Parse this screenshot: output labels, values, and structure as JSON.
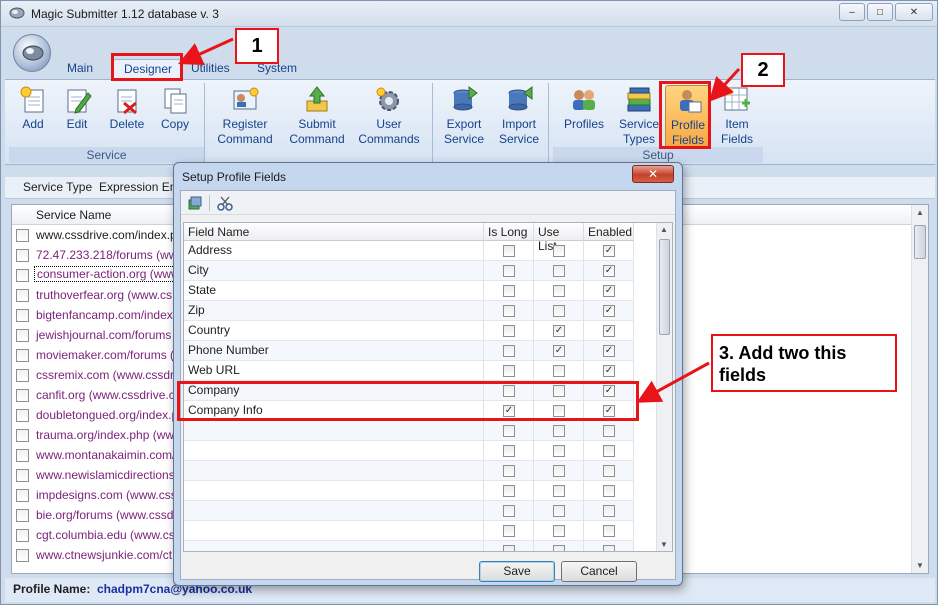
{
  "window": {
    "title": "Magic Submitter 1.12 database v. 3",
    "minimize": "–",
    "maximize": "□",
    "close": "✕"
  },
  "ribbon_tabs": [
    {
      "label": "Main"
    },
    {
      "label": "Designer"
    },
    {
      "label": "Utilities"
    },
    {
      "label": "System"
    }
  ],
  "ribbon": {
    "service_group": {
      "label": "Service",
      "buttons": [
        {
          "label": "Add"
        },
        {
          "label": "Edit"
        },
        {
          "label": "Delete"
        },
        {
          "label": "Copy"
        }
      ]
    },
    "command_group": {
      "buttons": [
        {
          "line1": "Register",
          "line2": "Command"
        },
        {
          "line1": "Submit",
          "line2": "Command"
        },
        {
          "line1": "User",
          "line2": "Commands"
        }
      ]
    },
    "export_group": {
      "buttons": [
        {
          "line1": "Export",
          "line2": "Service"
        },
        {
          "line1": "Import",
          "line2": "Service"
        }
      ]
    },
    "setup_group": {
      "label": "Setup",
      "buttons": [
        {
          "line1": "Profiles",
          "line2": ""
        },
        {
          "line1": "Service",
          "line2": "Types"
        },
        {
          "line1": "Profile",
          "line2": "Fields"
        },
        {
          "line1": "Item",
          "line2": "Fields"
        }
      ]
    }
  },
  "subbar": {
    "service_type": "Service Type",
    "expression": "Expression Eng"
  },
  "service_list": {
    "header": "Service Name",
    "rows": [
      "www.cssdrive.com/index.p",
      "72.47.233.218/forums  (ww",
      "consumer-action.org  (www",
      "truthoverfear.org  (www.cs",
      "bigtenfancamp.com/index.",
      "jewishjournal.com/forums  (",
      "moviemaker.com/forums  (",
      "cssremix.com (www.cssdri",
      "canfit.org (www.cssdrive.c",
      "doubletongued.org/index.p",
      "trauma.org/index.php  (ww",
      "www.montanakaimin.com/i",
      "www.newislamicdirections.",
      "impdesigns.com (www.css",
      "bie.org/forums  (www.cssdr",
      "cgt.columbia.edu  (www.cs",
      "www.ctnewsjunkie.com/ct"
    ]
  },
  "status": {
    "label": "Profile Name:",
    "value": "chadpm7cna@yahoo.co.uk"
  },
  "dialog": {
    "title": "Setup Profile Fields",
    "close": "✕",
    "columns": [
      "Field Name",
      "Is Long",
      "Use List",
      "Enabled"
    ],
    "rows": [
      {
        "name": "Address",
        "is_long": false,
        "use_list": false,
        "enabled": true
      },
      {
        "name": "City",
        "is_long": false,
        "use_list": false,
        "enabled": true
      },
      {
        "name": "State",
        "is_long": false,
        "use_list": false,
        "enabled": true
      },
      {
        "name": "Zip",
        "is_long": false,
        "use_list": false,
        "enabled": true
      },
      {
        "name": "Country",
        "is_long": false,
        "use_list": true,
        "enabled": true
      },
      {
        "name": "Phone Number",
        "is_long": false,
        "use_list": true,
        "enabled": true
      },
      {
        "name": "Web URL",
        "is_long": false,
        "use_list": false,
        "enabled": true
      },
      {
        "name": "Company",
        "is_long": false,
        "use_list": false,
        "enabled": true
      },
      {
        "name": "Company Info",
        "is_long": true,
        "use_list": false,
        "enabled": true
      },
      {
        "name": "",
        "is_long": false,
        "use_list": false,
        "enabled": false
      },
      {
        "name": "",
        "is_long": false,
        "use_list": false,
        "enabled": false
      },
      {
        "name": "",
        "is_long": false,
        "use_list": false,
        "enabled": false
      },
      {
        "name": "",
        "is_long": false,
        "use_list": false,
        "enabled": false
      },
      {
        "name": "",
        "is_long": false,
        "use_list": false,
        "enabled": false
      },
      {
        "name": "",
        "is_long": false,
        "use_list": false,
        "enabled": false
      },
      {
        "name": "",
        "is_long": false,
        "use_list": false,
        "enabled": false
      }
    ],
    "save": "Save",
    "cancel": "Cancel"
  },
  "annotations": {
    "step1": "1",
    "step2": "2",
    "step3_line1": "3. Add two this",
    "step3_line2": "fields",
    "color": "#e8141a"
  }
}
